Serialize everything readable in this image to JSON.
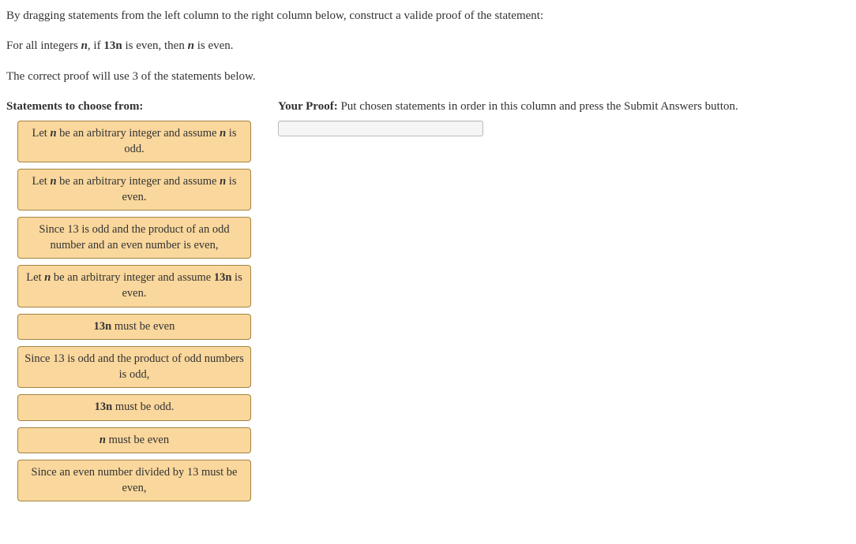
{
  "intro": {
    "line1_pre": "By dragging statements from the left column to the right column below, construct a valide proof of the statement:",
    "line2_a": "For all integers ",
    "line2_n": "n",
    "line2_b": ", if ",
    "line2_13n": "13n",
    "line2_c": " is even, then ",
    "line2_n2": "n",
    "line2_d": " is even.",
    "line3": "The correct proof will use 3 of the statements below."
  },
  "leftHeader": "Statements to choose from:",
  "rightHeaderBold": "Your Proof:",
  "rightHeaderRest": " Put chosen statements in order in this column and press the Submit Answers button.",
  "statements": [
    {
      "pre": "Let ",
      "v1": "n",
      "post": " be an arbitrary integer and assume ",
      "v2": "n",
      "tail": " is odd."
    },
    {
      "pre": "Let ",
      "v1": "n",
      "post": " be an arbitrary integer and assume ",
      "v2": "n",
      "tail": " is even."
    },
    {
      "pre": "Since 13 is odd and the product of an odd number and an even number is even,",
      "v1": "",
      "post": "",
      "v2": "",
      "tail": ""
    },
    {
      "pre": "Let ",
      "v1": "n",
      "post": " be an arbitrary integer and assume ",
      "v2": "13n",
      "tail": " is even."
    },
    {
      "pre": "",
      "v1": "13n",
      "post": " must be even",
      "v2": "",
      "tail": ""
    },
    {
      "pre": "Since 13 is odd and the product of odd numbers is odd,",
      "v1": "",
      "post": "",
      "v2": "",
      "tail": ""
    },
    {
      "pre": "",
      "v1": "13n",
      "post": " must be odd.",
      "v2": "",
      "tail": ""
    },
    {
      "pre": "",
      "v1": "n",
      "post": " must be even",
      "v2": "",
      "tail": ""
    },
    {
      "pre": "Since an even number divided by 13 must be even,",
      "v1": "",
      "post": "",
      "v2": "",
      "tail": ""
    }
  ]
}
